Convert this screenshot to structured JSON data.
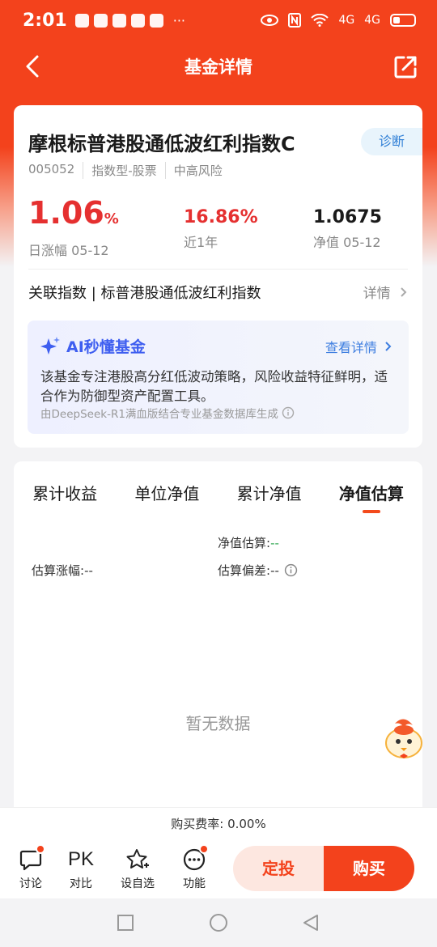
{
  "status_bar": {
    "time": "2:01",
    "more": "···",
    "signal_text": "4G"
  },
  "nav": {
    "title": "基金详情"
  },
  "fund": {
    "name": "摩根标普港股通低波红利指数C",
    "diagnose_label": "诊断",
    "code": "005052",
    "type": "指数型-股票",
    "risk": "中高风险",
    "day_change": "1.06",
    "day_change_pct": "%",
    "day_change_label": "日涨幅 05-12",
    "year_change": "16.86%",
    "year_change_label": "近1年",
    "nav_value": "1.0675",
    "nav_label": "净值 05-12",
    "related_index": "关联指数 | 标普港股通低波红利指数",
    "related_detail": "详情"
  },
  "ai": {
    "title": "AI秒懂基金",
    "link": "查看详情",
    "body": "该基金专注港股高分红低波动策略，风险收益特征鲜明，适合作为防御型资产配置工具。",
    "footer": "由DeepSeek-R1满血版结合专业基金数据库生成"
  },
  "chart": {
    "tabs": [
      {
        "label": "累计收益"
      },
      {
        "label": "单位净值"
      },
      {
        "label": "累计净值"
      },
      {
        "label": "净值估算"
      }
    ],
    "est_nav_label": "净值估算:",
    "est_nav_value": "--",
    "est_change_label": "估算涨幅:",
    "est_change_value": "--",
    "est_dev_label": "估算偏差:",
    "est_dev_value": "--",
    "no_data": "暂无数据"
  },
  "fee": {
    "text": "购买费率: 0.00%"
  },
  "bottom": {
    "items": [
      {
        "label": "讨论"
      },
      {
        "label": "对比",
        "glyph": "PK"
      },
      {
        "label": "设自选"
      },
      {
        "label": "功能"
      }
    ],
    "dingtou": "定投",
    "buy": "购买"
  },
  "colors": {
    "brand": "#f3421c",
    "up": "#e53030",
    "ai": "#3e5ef0"
  }
}
